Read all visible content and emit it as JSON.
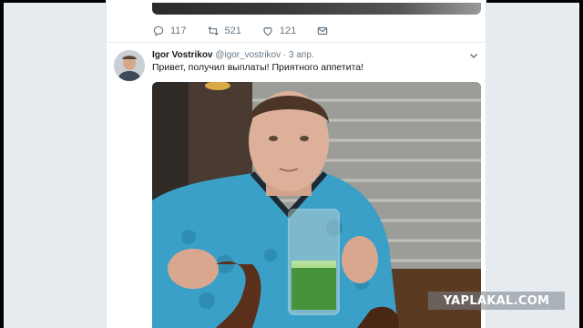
{
  "prev_tweet": {
    "actions": [
      {
        "icon": "reply-icon",
        "count": "117"
      },
      {
        "icon": "retweet-icon",
        "count": "521"
      },
      {
        "icon": "like-icon",
        "count": "121"
      },
      {
        "icon": "message-icon",
        "count": ""
      }
    ]
  },
  "tweet": {
    "name": "Igor Vostrikov",
    "handle": "@igor_vostrikov",
    "separator": "·",
    "date": "3 апр.",
    "text": "Привет, получил выплаты! Приятного аппетита!"
  },
  "watermark": "YAPLAKAL.COM",
  "colors": {
    "background": "#e6ecf0",
    "card": "#ffffff",
    "muted": "#657786",
    "text": "#14171a"
  }
}
